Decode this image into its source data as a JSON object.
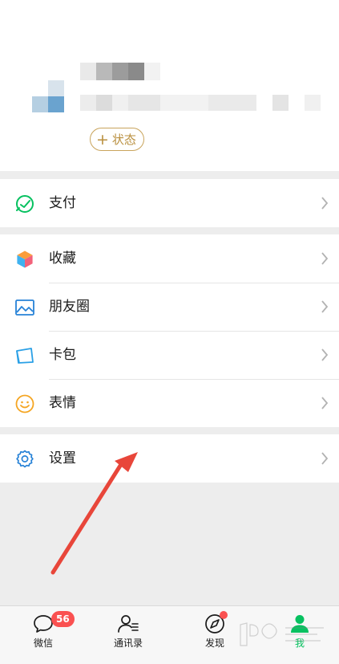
{
  "profile": {
    "status_plus": "+",
    "status_label": "状态"
  },
  "menu": {
    "pay": {
      "label": "支付",
      "icon": "pay-icon"
    },
    "favorites": {
      "label": "收藏",
      "icon": "favorites-icon"
    },
    "moments": {
      "label": "朋友圈",
      "icon": "moments-icon"
    },
    "cards": {
      "label": "卡包",
      "icon": "card-wallet-icon"
    },
    "stickers": {
      "label": "表情",
      "icon": "sticker-icon"
    },
    "settings": {
      "label": "设置",
      "icon": "gear-icon"
    }
  },
  "tabbar": {
    "chats": {
      "label": "微信",
      "badge": "56"
    },
    "contacts": {
      "label": "通讯录"
    },
    "discover": {
      "label": "发现"
    },
    "me": {
      "label": "我"
    }
  },
  "colors": {
    "accent_green": "#07c160",
    "badge_red": "#fa5151",
    "arrow_red": "#e8463a",
    "status_gold": "#c9a45c"
  }
}
